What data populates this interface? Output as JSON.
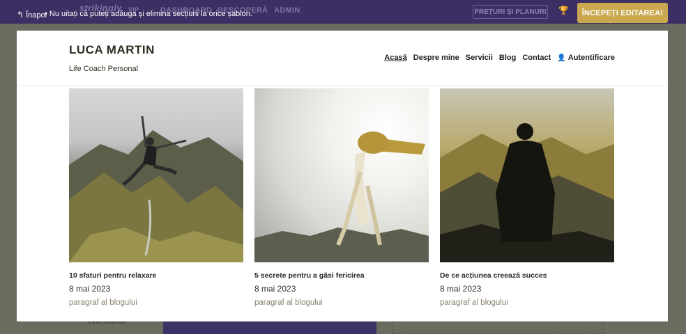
{
  "topbar": {
    "back_label": "Înapoi",
    "tip_text": "•  Nu uitați că puteți adăuga și elimina secțiuni la orice șablon.",
    "brand": "strikingly",
    "vip": "VIP",
    "nav_dashboard": "DASHBOARD",
    "nav_discover": "DESCOPERĂ",
    "nav_admin": "ADMIN",
    "pricing_button": "PREȚURI ȘI PLANURI",
    "start_button": "ÎNCEPEȚI EDITAREA!"
  },
  "background": {
    "footer_left": "evenimente"
  },
  "site": {
    "title": "LUCA MARTIN",
    "tagline": "Life Coach Personal",
    "nav": [
      "Acasă",
      "Despre mine",
      "Servicii",
      "Blog",
      "Contact"
    ],
    "login": "Autentificare"
  },
  "posts": [
    {
      "title": "10 sfaturi pentru relaxare",
      "date": "8 mai 2023",
      "excerpt": "paragraf al blogului"
    },
    {
      "title": "5 secrete pentru a găsi fericirea",
      "date": "8 mai 2023",
      "excerpt": "paragraf al blogului"
    },
    {
      "title": "De ce acțiunea creează succes",
      "date": "8 mai 2023",
      "excerpt": "paragraf al blogului"
    }
  ],
  "colors": {
    "topbar": "#3c2f63",
    "accent": "#c9a84f",
    "overlay": "#6b6c5f"
  }
}
